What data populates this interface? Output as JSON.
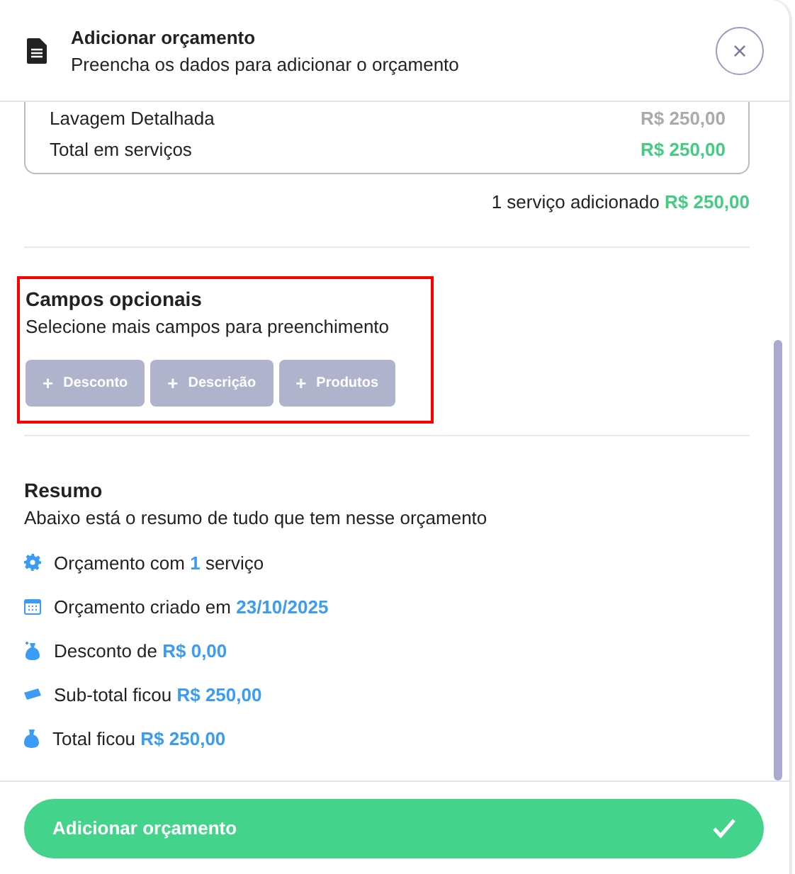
{
  "header": {
    "title": "Adicionar orçamento",
    "subtitle": "Preencha os dados para adicionar o orçamento",
    "close": "×"
  },
  "services": {
    "rows": [
      {
        "name": "Lavagem Detalhada",
        "value": "R$ 250,00"
      }
    ],
    "total_label": "Total em serviços",
    "total_value": "R$ 250,00"
  },
  "services_summary": {
    "text": "1 serviço adicionado",
    "value": "R$ 250,00"
  },
  "optional_fields": {
    "highlighted": true,
    "title": "Campos opcionais",
    "subtitle": "Selecione mais campos para preenchimento",
    "buttons": [
      {
        "icon": "+",
        "label": "Desconto"
      },
      {
        "icon": "+",
        "label": "Descrição"
      },
      {
        "icon": "+",
        "label": "Produtos"
      }
    ]
  },
  "summary": {
    "title": "Resumo",
    "subtitle": "Abaixo está o resumo de tudo que tem nesse orçamento",
    "items": [
      {
        "kind": "gear",
        "text": "Orçamento com **1** serviço"
      },
      {
        "kind": "calendar",
        "text": "Orçamento criado em **23/10/2025**"
      },
      {
        "kind": "discount",
        "text": "Desconto de **R$ 0,00**"
      },
      {
        "kind": "ticket",
        "text": "Sub-total ficou **R$ 250,00**"
      },
      {
        "kind": "bag",
        "text": "Total ficou **R$ 250,00**"
      }
    ]
  },
  "submit": {
    "label": "Adicionar orçamento"
  }
}
